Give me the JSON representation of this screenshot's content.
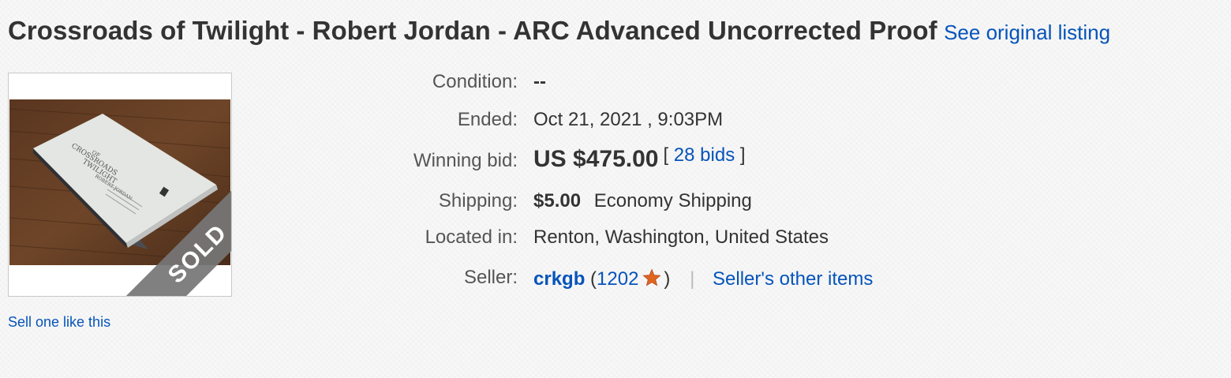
{
  "listing": {
    "title": "Crossroads of Twilight - Robert Jordan - ARC Advanced Uncorrected Proof",
    "see_original_label": "See original listing"
  },
  "image": {
    "sold_label": "SOLD"
  },
  "sell_one_label": "Sell one like this",
  "details": {
    "condition": {
      "label": "Condition:",
      "value": "--"
    },
    "ended": {
      "label": "Ended:",
      "value": "Oct 21, 2021 , 9:03PM"
    },
    "winning_bid": {
      "label": "Winning bid:",
      "price": "US $475.00",
      "bracket_open": "[",
      "bids": "28 bids",
      "bracket_close": "]"
    },
    "shipping": {
      "label": "Shipping:",
      "cost": "$5.00",
      "method": "Economy Shipping"
    },
    "location": {
      "label": "Located in:",
      "value": "Renton, Washington, United States"
    },
    "seller": {
      "label": "Seller:",
      "name": "crkgb",
      "paren_open": "(",
      "feedback": "1202",
      "paren_close": ")",
      "separator": "|",
      "other_items": "Seller's other items"
    }
  },
  "colors": {
    "link": "#0654ba",
    "star": "#e0651f"
  },
  "icons": {
    "feedback_star": "star-icon"
  }
}
